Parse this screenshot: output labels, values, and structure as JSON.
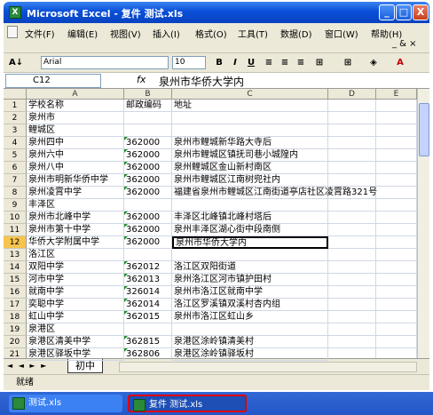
{
  "window": {
    "title": "Microsoft Excel - 复件 测试.xls",
    "controls": {
      "minimize": "_",
      "maximize": "□",
      "close": "X"
    }
  },
  "menu": {
    "items": [
      "文件(F)",
      "编辑(E)",
      "视图(V)",
      "插入(I)",
      "格式(O)",
      "工具(T)",
      "数据(D)",
      "窗口(W)",
      "帮助(H)"
    ],
    "doc_controls": "_ & ×"
  },
  "toolbar": {
    "sort_label": "A↓",
    "font_name": "Arial",
    "font_size": "10",
    "bold": "B",
    "italic": "I",
    "underline": "U",
    "fill_color": "#ffff00",
    "font_color": "#ff0000"
  },
  "formula_bar": {
    "cell_ref": "C12",
    "fx": "fx",
    "content": "泉州市华侨大学内"
  },
  "columns": [
    "A",
    "B",
    "C",
    "D",
    "E"
  ],
  "rows": [
    {
      "num": "1",
      "a": "学校名称",
      "b": "邮政编码",
      "c": "地址"
    },
    {
      "num": "2",
      "a": "泉州市",
      "b": "",
      "c": ""
    },
    {
      "num": "3",
      "a": "鲤城区",
      "b": "",
      "c": ""
    },
    {
      "num": "4",
      "a": "泉州四中",
      "b": "362000",
      "c": "泉州市鲤城新华路大寺后"
    },
    {
      "num": "5",
      "a": "泉州六中",
      "b": "362000",
      "c": "泉州市鲤城区镇抚司巷小城隍内"
    },
    {
      "num": "6",
      "a": "泉州八中",
      "b": "362000",
      "c": "泉州鲤城区金山新村南区"
    },
    {
      "num": "7",
      "a": "泉州市明新华侨中学",
      "b": "362000",
      "c": "泉州市鲤城区江南树兜社内"
    },
    {
      "num": "8",
      "a": "泉州凌霄中学",
      "b": "362000",
      "c": "福建省泉州市鲤城区江南街道亭店社区凌霄路321号"
    },
    {
      "num": "9",
      "a": "丰泽区",
      "b": "",
      "c": ""
    },
    {
      "num": "10",
      "a": "泉州市北峰中学",
      "b": "362000",
      "c": "丰泽区北峰镇北峰村塔后"
    },
    {
      "num": "11",
      "a": "泉州市第十中学",
      "b": "362000",
      "c": "泉州丰泽区湖心街中段南侧"
    },
    {
      "num": "12",
      "a": "华侨大学附属中学",
      "b": "362000",
      "c": "泉州市华侨大学内"
    },
    {
      "num": "13",
      "a": "洛江区",
      "b": "",
      "c": ""
    },
    {
      "num": "14",
      "a": "双阳中学",
      "b": "362012",
      "c": "洛江区双阳街道"
    },
    {
      "num": "15",
      "a": "河市中学",
      "b": "362013",
      "c": "泉州洛江区河市镇护田村"
    },
    {
      "num": "16",
      "a": "就南中学",
      "b": "326014",
      "c": "泉州市洛江区就南中学"
    },
    {
      "num": "17",
      "a": "奕聪中学",
      "b": "362014",
      "c": "洛江区罗溪镇双溪村杏内组"
    },
    {
      "num": "18",
      "a": "虹山中学",
      "b": "362015",
      "c": "泉州市洛江区虹山乡"
    },
    {
      "num": "19",
      "a": "泉港区",
      "b": "",
      "c": ""
    },
    {
      "num": "20",
      "a": "泉港区清美中学",
      "b": "362815",
      "c": "泉港区涂岭镇清美村"
    },
    {
      "num": "21",
      "a": "泉港区驿坂中学",
      "b": "362806",
      "c": "泉港区涂岭镇驿坂村"
    }
  ],
  "active_row": "12",
  "sheet_tabs": {
    "arrows": "◄ ◄ ► ►",
    "active": "初中"
  },
  "status": "就绪",
  "taskbar": [
    {
      "label": "测试.xls"
    },
    {
      "label": "复件 测试.xls"
    }
  ]
}
